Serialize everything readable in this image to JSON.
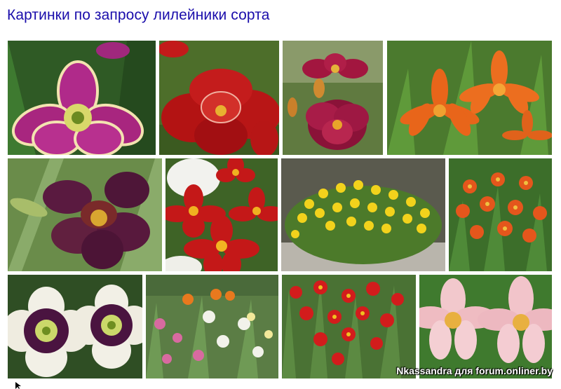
{
  "page": {
    "title": "Картинки по запросу лилейники сорта"
  },
  "results": {
    "images": [
      {
        "name": "Фиолетово-розовый лилейник с гофрированной каймой"
      },
      {
        "name": "Красный махровый лилейник"
      },
      {
        "name": "Бордовый махровый лилейник"
      },
      {
        "name": "Оранжевые лилейники"
      },
      {
        "name": "Тёмно-фиолетовый лилейник с каплями"
      },
      {
        "name": "Красные лилейники и белая гортензия"
      },
      {
        "name": "Куст жёлтых лилейников"
      },
      {
        "name": "Оранжево-красные лилейники"
      },
      {
        "name": "Белые лилейники с фиолетовым глазком"
      },
      {
        "name": "Клумба с лилейниками"
      },
      {
        "name": "Красные лилейники в саду"
      },
      {
        "name": "Розовые лилейники"
      }
    ]
  },
  "watermark": "Nkassandra для forum.onliner.by",
  "colors": {
    "link": "#1a0dab"
  }
}
